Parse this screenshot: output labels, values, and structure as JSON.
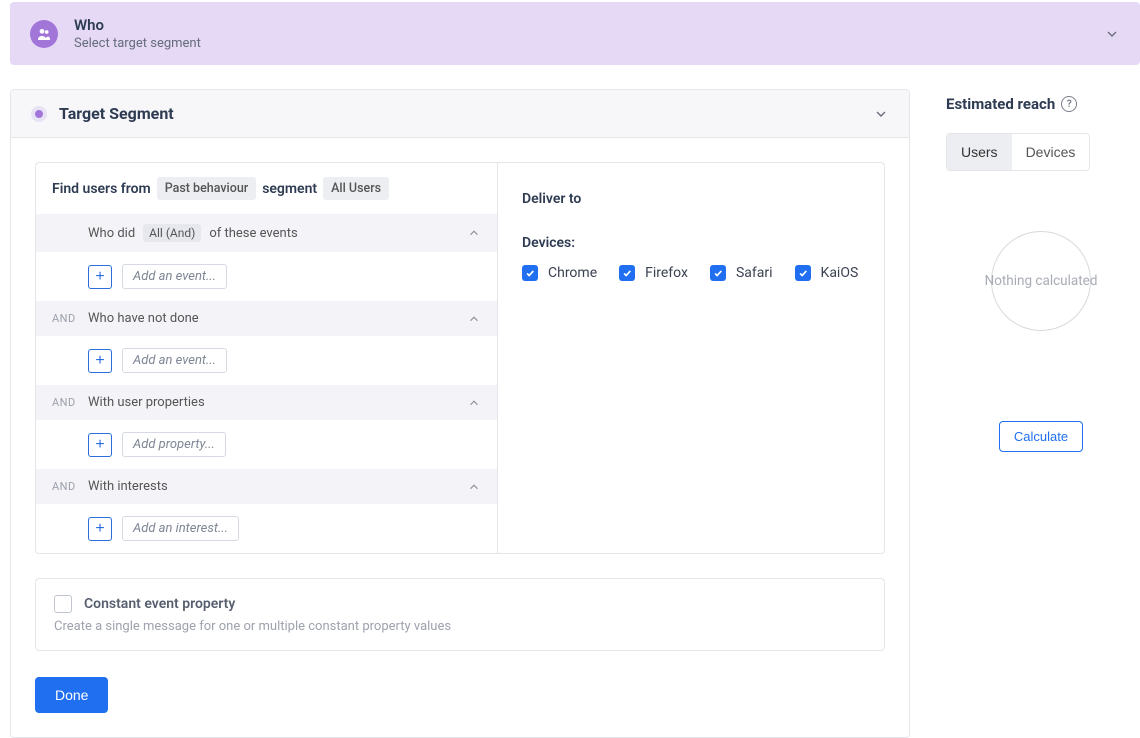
{
  "banner": {
    "title": "Who",
    "subtitle": "Select target segment"
  },
  "segment": {
    "header": "Target Segment",
    "find_prefix": "Find users from",
    "find_chip": "Past behaviour",
    "find_mid": "segment",
    "find_chip2": "All Users",
    "conditions": [
      {
        "and": "",
        "prefix": "Who did",
        "inline_chip": "All (And)",
        "suffix": "of these events",
        "add_label": "Add an event..."
      },
      {
        "and": "AND",
        "prefix": "Who have not done",
        "inline_chip": "",
        "suffix": "",
        "add_label": "Add an event..."
      },
      {
        "and": "AND",
        "prefix": "With user properties",
        "inline_chip": "",
        "suffix": "",
        "add_label": "Add property..."
      },
      {
        "and": "AND",
        "prefix": "With interests",
        "inline_chip": "",
        "suffix": "",
        "add_label": "Add an interest..."
      }
    ]
  },
  "deliver": {
    "title": "Deliver to",
    "devices_label": "Devices:",
    "devices": [
      "Chrome",
      "Firefox",
      "Safari",
      "KaiOS"
    ]
  },
  "constant": {
    "title": "Constant event property",
    "subtitle": "Create a single message for one or multiple constant property values"
  },
  "done_label": "Done",
  "reach": {
    "title": "Estimated reach",
    "tabs": [
      "Users",
      "Devices"
    ],
    "empty": "Nothing calculated",
    "calc": "Calculate"
  }
}
